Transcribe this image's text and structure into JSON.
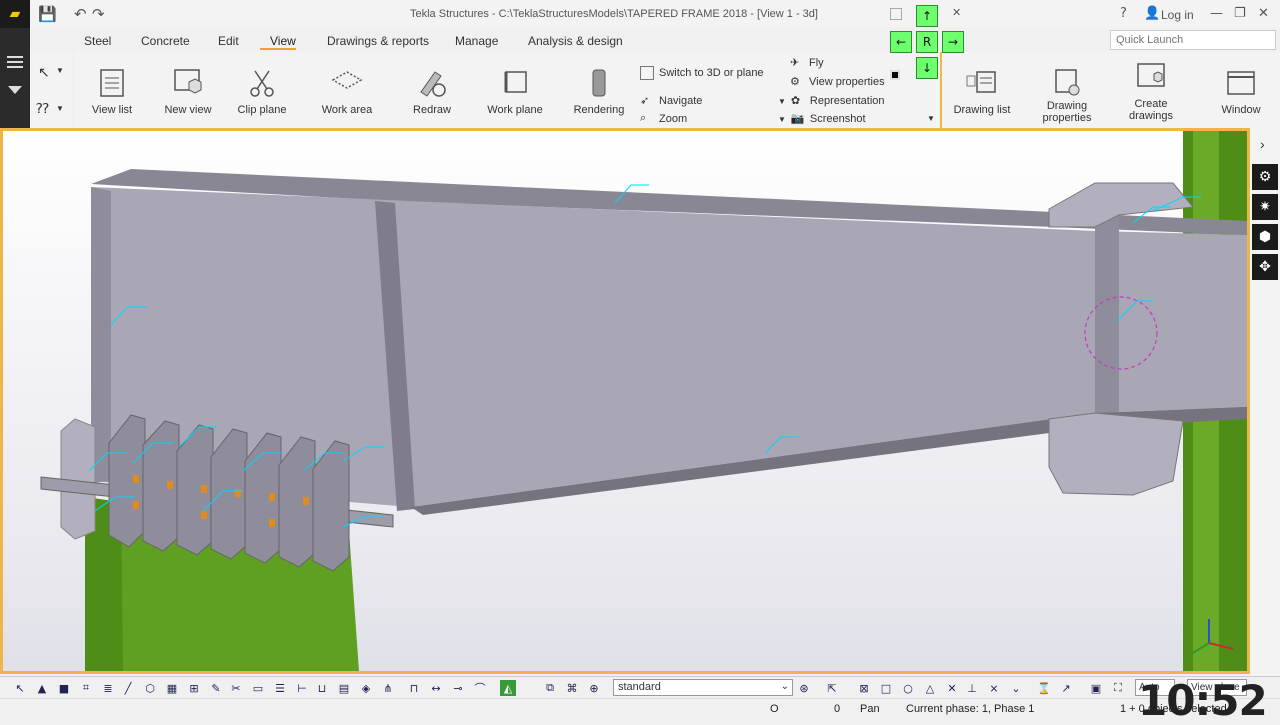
{
  "window": {
    "title": "Tekla Structures - C:\\TeklaStructuresModels\\TAPERED FRAME 2018  - [View 1 - 3d]",
    "login": "Log in",
    "help": "?",
    "quick_launch_placeholder": "Quick Launch"
  },
  "tabs": [
    {
      "label": "Steel"
    },
    {
      "label": "Concrete"
    },
    {
      "label": "Edit"
    },
    {
      "label": "View"
    },
    {
      "label": "Drawings & reports"
    },
    {
      "label": "Manage"
    },
    {
      "label": "Analysis & design"
    }
  ],
  "active_tab": "View",
  "ribbon": {
    "view_list": "View list",
    "new_view": "New view",
    "clip_plane": "Clip plane",
    "work_area": "Work area",
    "redraw": "Redraw",
    "work_plane": "Work plane",
    "rendering": "Rendering",
    "switch_3d": "Switch to 3D or plane",
    "navigate": "Navigate",
    "zoom": "Zoom",
    "fly": "Fly",
    "view_properties": "View properties",
    "representation": "Representation",
    "screenshot": "Screenshot",
    "drawing_list": "Drawing list",
    "drawing_properties_1": "Drawing",
    "drawing_properties_2": "properties",
    "create_drawings_1": "Create",
    "create_drawings_2": "drawings",
    "window": "Window"
  },
  "navigator": {
    "up": "↑",
    "down": "↓",
    "left": "←",
    "right": "→",
    "center": "R"
  },
  "bottom_toolbar": {
    "view_filter": "standard",
    "auto": "Auto",
    "view_plane": "View plane"
  },
  "status": {
    "o_label": "O",
    "zero": "0",
    "mode": "Pan",
    "phase": "Current phase: 1, Phase 1",
    "selection": "1 + 0 objects selected"
  },
  "clock": "10:52",
  "colors": {
    "accent": "#f0b54a",
    "beam": "#a9a6b6",
    "column": "#5a9e1e",
    "nav_green": "#6dff6d"
  }
}
